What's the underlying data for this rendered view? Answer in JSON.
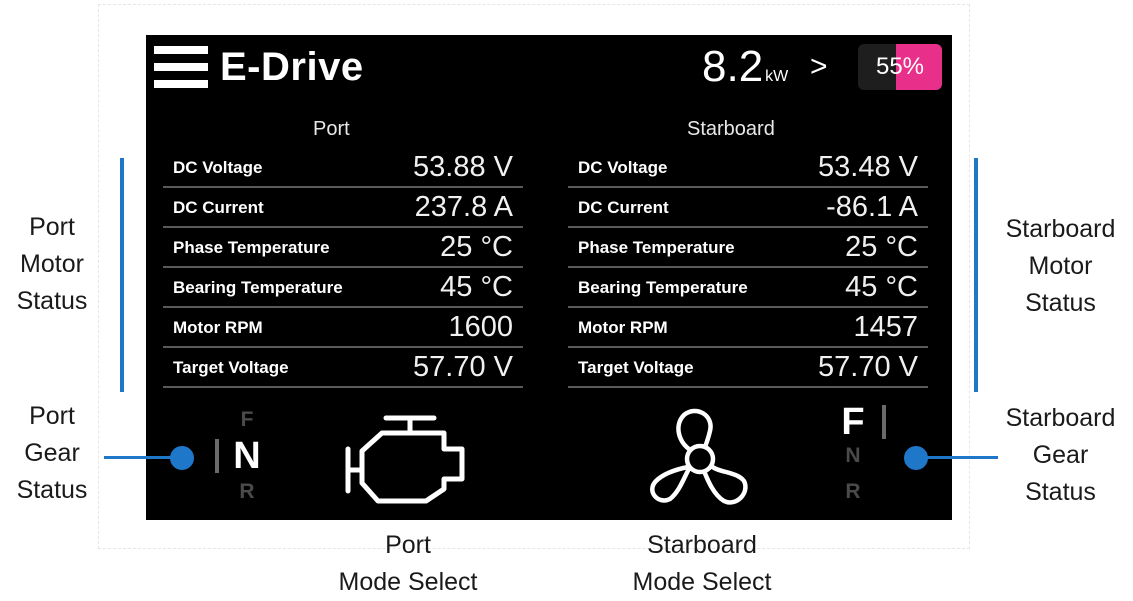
{
  "header": {
    "title": "E-Drive",
    "power_value": "8.2",
    "power_unit": "kW",
    "chevron": ">",
    "battery_percent": 55,
    "battery_label": "55%"
  },
  "colors": {
    "accent": "#e8308a",
    "annotation": "#1f77c9",
    "screen_bg": "#000000"
  },
  "port": {
    "heading": "Port",
    "rows": [
      {
        "label": "DC Voltage",
        "value": "53.88 V"
      },
      {
        "label": "DC Current",
        "value": "237.8 A"
      },
      {
        "label": "Phase Temperature",
        "value": "25 °C"
      },
      {
        "label": "Bearing Temperature",
        "value": "45 °C"
      },
      {
        "label": "Motor RPM",
        "value": "1600"
      },
      {
        "label": "Target Voltage",
        "value": "57.70 V"
      }
    ],
    "gear": {
      "f": "F",
      "n": "N",
      "r": "R",
      "selected": "N"
    },
    "mode_icon": "engine-icon"
  },
  "starboard": {
    "heading": "Starboard",
    "rows": [
      {
        "label": "DC Voltage",
        "value": "53.48 V"
      },
      {
        "label": "DC Current",
        "value": "-86.1 A"
      },
      {
        "label": "Phase Temperature",
        "value": "25 °C"
      },
      {
        "label": "Bearing Temperature",
        "value": "45 °C"
      },
      {
        "label": "Motor RPM",
        "value": "1457"
      },
      {
        "label": "Target Voltage",
        "value": "57.70 V"
      }
    ],
    "gear": {
      "f": "F",
      "n": "N",
      "r": "R",
      "selected": "F"
    },
    "mode_icon": "propeller-icon"
  },
  "annotations": {
    "port_motor_status": [
      "Port",
      "Motor",
      "Status"
    ],
    "starboard_motor_status": [
      "Starboard",
      "Motor",
      "Status"
    ],
    "port_gear_status": [
      "Port",
      "Gear",
      "Status"
    ],
    "starboard_gear_status": [
      "Starboard",
      "Gear",
      "Status"
    ],
    "port_mode_select": [
      "Port",
      "Mode Select"
    ],
    "starboard_mode_select": [
      "Starboard",
      "Mode Select"
    ]
  }
}
